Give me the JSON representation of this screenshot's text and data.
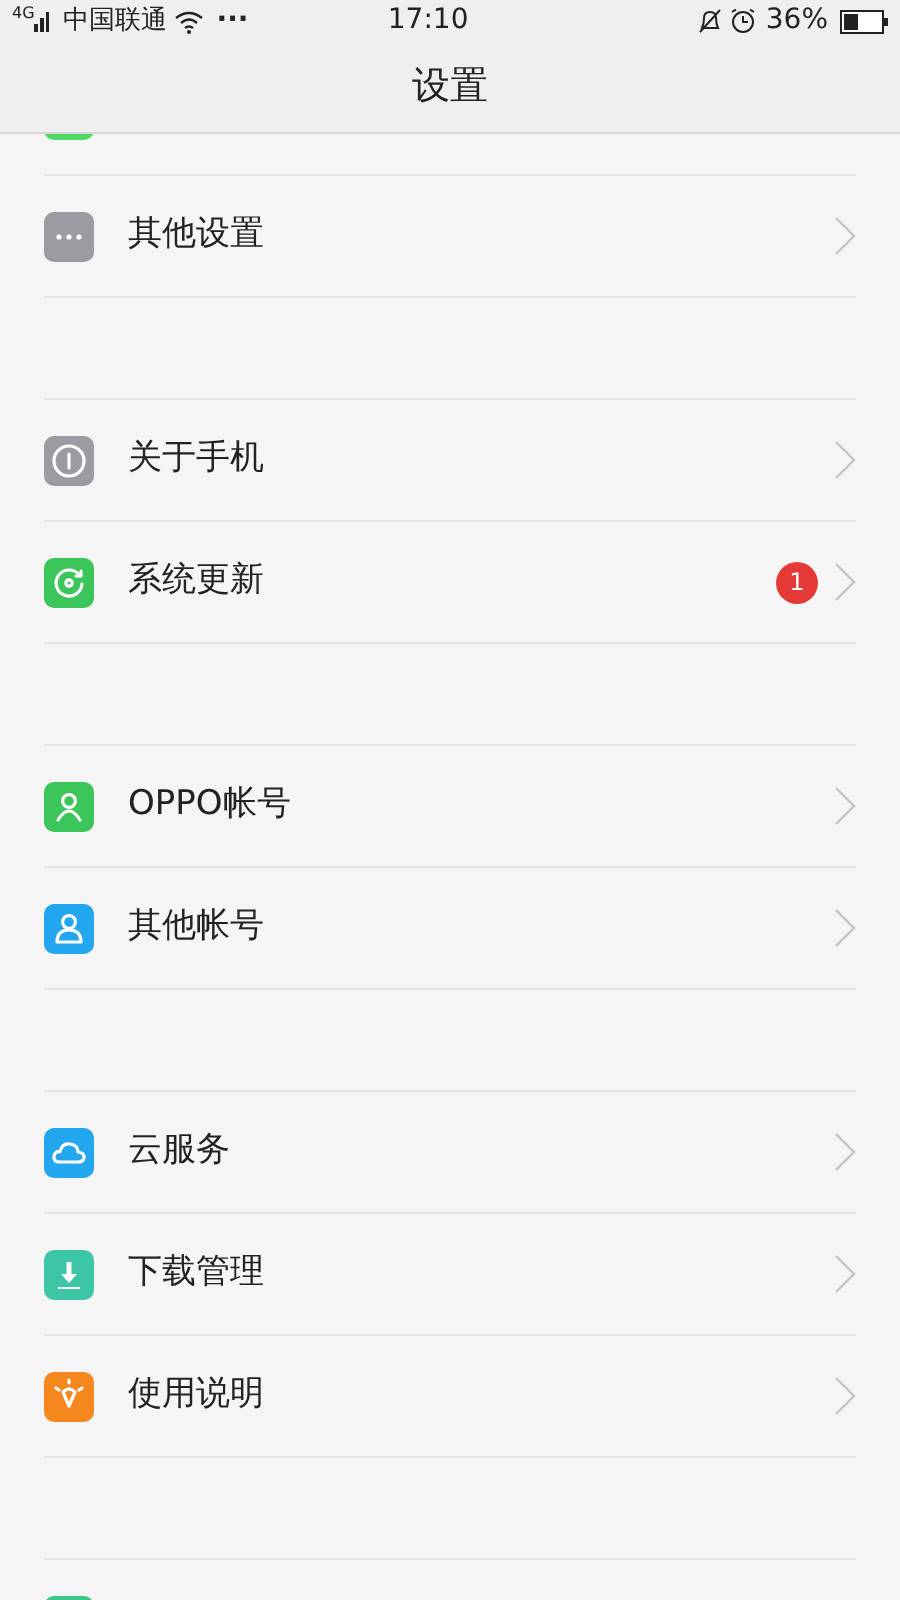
{
  "status_bar": {
    "network": "4G",
    "carrier": "中国联通",
    "more": "···",
    "time": "17:10",
    "battery": "36%"
  },
  "header": {
    "title": "设置"
  },
  "groups": [
    [
      {
        "kind": "clipped",
        "color": "#4cd964"
      },
      {
        "kind": "item",
        "color": "#9a9ca1",
        "label": "其他设置"
      }
    ],
    [
      {
        "kind": "item",
        "color": "#9a9ca1",
        "label": "关于手机"
      },
      {
        "kind": "item",
        "color": "#3cc55a",
        "label": "系统更新",
        "badge": "1"
      }
    ],
    [
      {
        "kind": "item",
        "color": "#3cc55a",
        "label": "OPPO帐号"
      },
      {
        "kind": "item",
        "color": "#22a7ef",
        "label": "其他帐号"
      }
    ],
    [
      {
        "kind": "item",
        "color": "#22a7ef",
        "label": "云服务"
      },
      {
        "kind": "item",
        "color": "#3cc6a6",
        "label": "下载管理"
      },
      {
        "kind": "item",
        "color": "#f5871f",
        "label": "使用说明"
      }
    ],
    [
      {
        "kind": "clipped_bottom",
        "color": "#3cc68a"
      }
    ]
  ]
}
